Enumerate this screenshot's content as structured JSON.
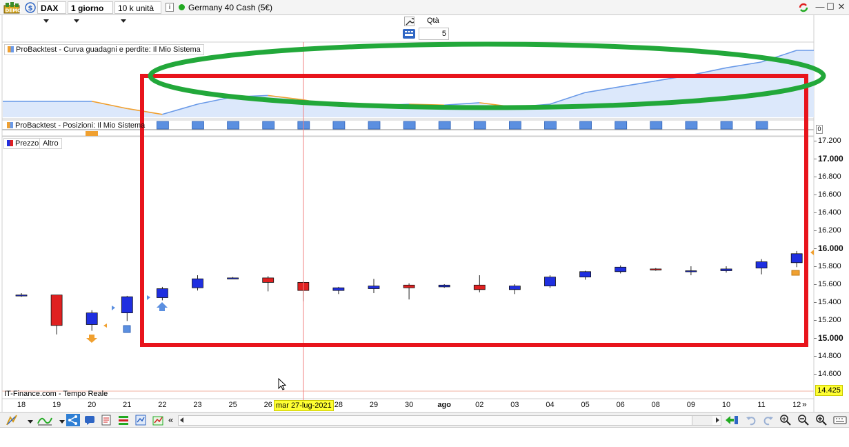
{
  "toolbar": {
    "demo_badge": "DEMO",
    "instrument": "DAX",
    "timeframe": "1 giorno",
    "units": "10 k unità",
    "info_icon": "i",
    "market_status_color": "#22aa22",
    "market_name": "Germany 40 Cash (5€)"
  },
  "order": {
    "qty_label": "Qtà",
    "qty_value": "5"
  },
  "panels": {
    "equity_label": "ProBacktest - Curva guadagni e perdite: Il Mio Sistema",
    "positions_label": "ProBacktest - Posizioni: Il Mio Sistema",
    "positions_value": "0",
    "price_label": "Prezzo",
    "other_label": "Altro"
  },
  "colors": {
    "bull": "#1f2fe0",
    "bear": "#e02020",
    "equity_up": "#6a9ae8",
    "equity_down": "#f0a030",
    "red_box": "#e8141c",
    "green_ellipse": "#22a83a",
    "highlight": "#ffff33"
  },
  "yaxis": {
    "labels": [
      {
        "text": "17.200",
        "value": 17200,
        "bold": false
      },
      {
        "text": "17.000",
        "value": 17000,
        "bold": true
      },
      {
        "text": "16.800",
        "value": 16800,
        "bold": false
      },
      {
        "text": "16.600",
        "value": 16600,
        "bold": false
      },
      {
        "text": "16.400",
        "value": 16400,
        "bold": false
      },
      {
        "text": "16.200",
        "value": 16200,
        "bold": false
      },
      {
        "text": "16.000",
        "value": 16000,
        "bold": true
      },
      {
        "text": "15.800",
        "value": 15800,
        "bold": false
      },
      {
        "text": "15.600",
        "value": 15600,
        "bold": false
      },
      {
        "text": "15.400",
        "value": 15400,
        "bold": false
      },
      {
        "text": "15.200",
        "value": 15200,
        "bold": false
      },
      {
        "text": "15.000",
        "value": 15000,
        "bold": true
      },
      {
        "text": "14.800",
        "value": 14800,
        "bold": false
      },
      {
        "text": "14.600",
        "value": 14600,
        "bold": false
      }
    ],
    "current_price": "14.425"
  },
  "xaxis": {
    "labels": [
      {
        "text": "18",
        "bold": false
      },
      {
        "text": "19",
        "bold": false
      },
      {
        "text": "20",
        "bold": false
      },
      {
        "text": "21",
        "bold": false
      },
      {
        "text": "22",
        "bold": false
      },
      {
        "text": "23",
        "bold": false
      },
      {
        "text": "25",
        "bold": false
      },
      {
        "text": "26",
        "bold": false
      },
      {
        "text": "",
        "bold": false
      },
      {
        "text": "28",
        "bold": false
      },
      {
        "text": "29",
        "bold": false
      },
      {
        "text": "30",
        "bold": false
      },
      {
        "text": "ago",
        "bold": true
      },
      {
        "text": "02",
        "bold": false
      },
      {
        "text": "03",
        "bold": false
      },
      {
        "text": "04",
        "bold": false
      },
      {
        "text": "05",
        "bold": false
      },
      {
        "text": "06",
        "bold": false
      },
      {
        "text": "08",
        "bold": false
      },
      {
        "text": "09",
        "bold": false
      },
      {
        "text": "10",
        "bold": false
      },
      {
        "text": "11",
        "bold": false
      },
      {
        "text": "12",
        "bold": false
      }
    ],
    "cursor_date": "mar 27-lug-2021",
    "next_page": "»"
  },
  "footer": {
    "source": "IT-Finance.com - Tempo Reale",
    "scroll_left": "«"
  },
  "chart_data": {
    "type": "candlestick",
    "candles": [
      {
        "o": 15480,
        "h": 15500,
        "l": 15460,
        "c": 15480
      },
      {
        "o": 15480,
        "h": 15480,
        "l": 15040,
        "c": 15140
      },
      {
        "o": 15150,
        "h": 15310,
        "l": 15080,
        "c": 15280
      },
      {
        "o": 15280,
        "h": 15470,
        "l": 15190,
        "c": 15460
      },
      {
        "o": 15450,
        "h": 15570,
        "l": 15420,
        "c": 15550
      },
      {
        "o": 15560,
        "h": 15700,
        "l": 15530,
        "c": 15660
      },
      {
        "o": 15665,
        "h": 15680,
        "l": 15660,
        "c": 15670
      },
      {
        "o": 15670,
        "h": 15690,
        "l": 15520,
        "c": 15620
      },
      {
        "o": 15620,
        "h": 15640,
        "l": 15410,
        "c": 15530
      },
      {
        "o": 15530,
        "h": 15570,
        "l": 15490,
        "c": 15560
      },
      {
        "o": 15550,
        "h": 15660,
        "l": 15500,
        "c": 15580
      },
      {
        "o": 15590,
        "h": 15610,
        "l": 15430,
        "c": 15560
      },
      {
        "o": 15570,
        "h": 15600,
        "l": 15560,
        "c": 15590
      },
      {
        "o": 15590,
        "h": 15700,
        "l": 15510,
        "c": 15540
      },
      {
        "o": 15540,
        "h": 15600,
        "l": 15490,
        "c": 15580
      },
      {
        "o": 15580,
        "h": 15700,
        "l": 15560,
        "c": 15680
      },
      {
        "o": 15680,
        "h": 15750,
        "l": 15650,
        "c": 15740
      },
      {
        "o": 15740,
        "h": 15810,
        "l": 15720,
        "c": 15790
      },
      {
        "o": 15770,
        "h": 15780,
        "l": 15750,
        "c": 15760
      },
      {
        "o": 15750,
        "h": 15800,
        "l": 15700,
        "c": 15750
      },
      {
        "o": 15750,
        "h": 15800,
        "l": 15730,
        "c": 15770
      },
      {
        "o": 15780,
        "h": 15880,
        "l": 15710,
        "c": 15850
      },
      {
        "o": 15840,
        "h": 15970,
        "l": 15790,
        "c": 15940
      }
    ],
    "equity_curve": [
      0.55,
      0.55,
      0.55,
      0.3,
      0.1,
      0.45,
      0.7,
      0.75,
      0.6,
      0.38,
      0.4,
      0.45,
      0.42,
      0.5,
      0.35,
      0.45,
      0.85,
      1.05,
      1.25,
      1.45,
      1.7,
      1.9,
      2.3,
      2.3
    ],
    "ylim": [
      14425,
      17300
    ]
  }
}
